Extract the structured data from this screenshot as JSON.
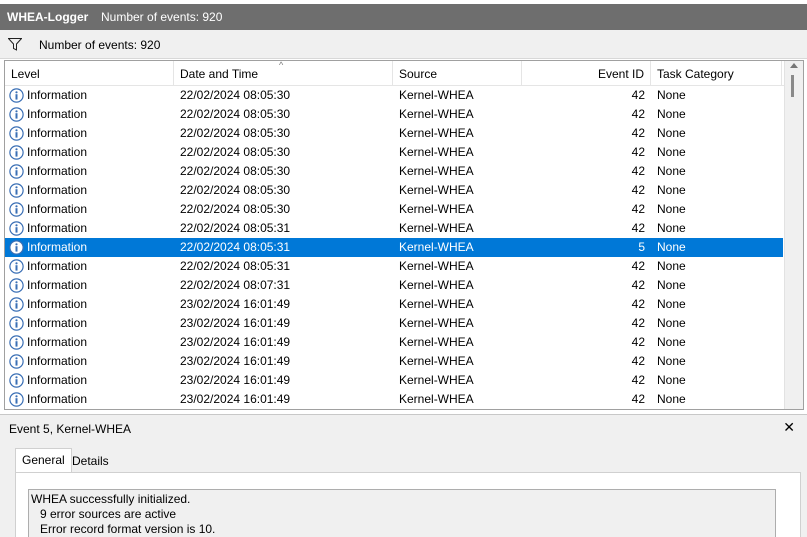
{
  "titlebar": {
    "name": "WHEA-Logger",
    "count": "Number of events: 920"
  },
  "filter": {
    "text": "Number of events: 920"
  },
  "columns": {
    "level": "Level",
    "date": "Date and Time",
    "source": "Source",
    "event_id": "Event ID",
    "task": "Task Category"
  },
  "rows": [
    {
      "level": "Information",
      "date": "22/02/2024 08:05:30",
      "source": "Kernel-WHEA",
      "event_id": "42",
      "task": "None"
    },
    {
      "level": "Information",
      "date": "22/02/2024 08:05:30",
      "source": "Kernel-WHEA",
      "event_id": "42",
      "task": "None"
    },
    {
      "level": "Information",
      "date": "22/02/2024 08:05:30",
      "source": "Kernel-WHEA",
      "event_id": "42",
      "task": "None"
    },
    {
      "level": "Information",
      "date": "22/02/2024 08:05:30",
      "source": "Kernel-WHEA",
      "event_id": "42",
      "task": "None"
    },
    {
      "level": "Information",
      "date": "22/02/2024 08:05:30",
      "source": "Kernel-WHEA",
      "event_id": "42",
      "task": "None"
    },
    {
      "level": "Information",
      "date": "22/02/2024 08:05:30",
      "source": "Kernel-WHEA",
      "event_id": "42",
      "task": "None"
    },
    {
      "level": "Information",
      "date": "22/02/2024 08:05:30",
      "source": "Kernel-WHEA",
      "event_id": "42",
      "task": "None"
    },
    {
      "level": "Information",
      "date": "22/02/2024 08:05:31",
      "source": "Kernel-WHEA",
      "event_id": "42",
      "task": "None"
    },
    {
      "level": "Information",
      "date": "22/02/2024 08:05:31",
      "source": "Kernel-WHEA",
      "event_id": "5",
      "task": "None",
      "selected": true
    },
    {
      "level": "Information",
      "date": "22/02/2024 08:05:31",
      "source": "Kernel-WHEA",
      "event_id": "42",
      "task": "None"
    },
    {
      "level": "Information",
      "date": "22/02/2024 08:07:31",
      "source": "Kernel-WHEA",
      "event_id": "42",
      "task": "None"
    },
    {
      "level": "Information",
      "date": "23/02/2024 16:01:49",
      "source": "Kernel-WHEA",
      "event_id": "42",
      "task": "None"
    },
    {
      "level": "Information",
      "date": "23/02/2024 16:01:49",
      "source": "Kernel-WHEA",
      "event_id": "42",
      "task": "None"
    },
    {
      "level": "Information",
      "date": "23/02/2024 16:01:49",
      "source": "Kernel-WHEA",
      "event_id": "42",
      "task": "None"
    },
    {
      "level": "Information",
      "date": "23/02/2024 16:01:49",
      "source": "Kernel-WHEA",
      "event_id": "42",
      "task": "None"
    },
    {
      "level": "Information",
      "date": "23/02/2024 16:01:49",
      "source": "Kernel-WHEA",
      "event_id": "42",
      "task": "None"
    },
    {
      "level": "Information",
      "date": "23/02/2024 16:01:49",
      "source": "Kernel-WHEA",
      "event_id": "42",
      "task": "None"
    }
  ],
  "detail": {
    "title": "Event 5, Kernel-WHEA",
    "close": "✕",
    "tabs": [
      "General",
      "Details"
    ],
    "lines": [
      "WHEA successfully initialized.",
      "9 error sources are active",
      "Error record format version is 10."
    ]
  },
  "colors": {
    "selection": "#0078d7",
    "titlebar": "#6e6e6e",
    "info_icon": "#3a6fb5"
  },
  "icons": {
    "filter": "filter-icon",
    "info": "information-icon",
    "close": "close-icon"
  }
}
